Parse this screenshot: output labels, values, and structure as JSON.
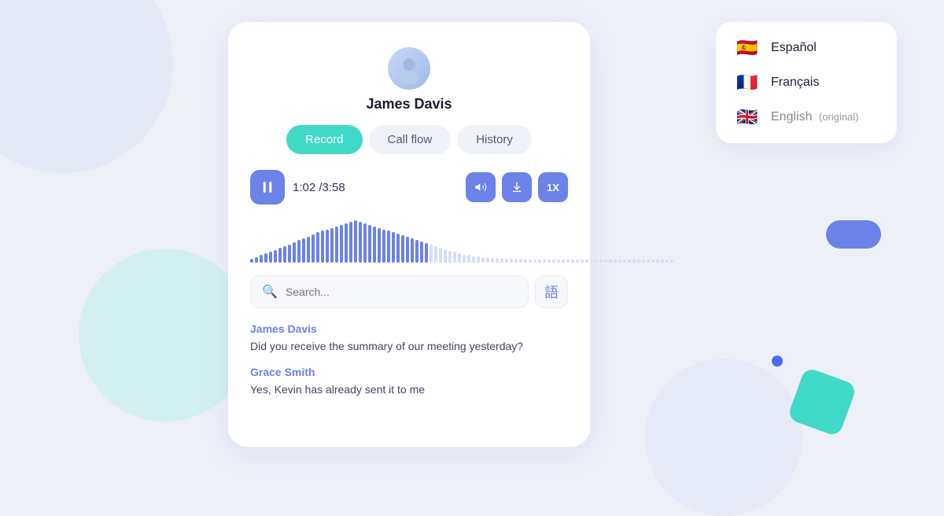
{
  "user": {
    "name": "James Davis"
  },
  "tabs": [
    {
      "id": "record",
      "label": "Record",
      "active": true
    },
    {
      "id": "callflow",
      "label": "Call flow",
      "active": false
    },
    {
      "id": "history",
      "label": "History",
      "active": false
    }
  ],
  "player": {
    "current_time": "1:02",
    "total_time": "3:58",
    "time_display": "1:02 /3:58",
    "speed_label": "1X"
  },
  "search": {
    "placeholder": "Search..."
  },
  "transcript": [
    {
      "speaker": "James Davis",
      "text": "Did you receive the summary of our meeting yesterday?"
    },
    {
      "speaker": "Grace Smith",
      "text": "Yes, Kevin has already sent it to me"
    }
  ],
  "languages": [
    {
      "flag": "🇪🇸",
      "name": "Español",
      "note": ""
    },
    {
      "flag": "🇫🇷",
      "name": "Français",
      "note": ""
    },
    {
      "flag": "🇬🇧",
      "name": "English",
      "note": "(original)"
    }
  ],
  "waveform": {
    "bars": [
      3,
      5,
      8,
      10,
      12,
      15,
      18,
      20,
      22,
      25,
      28,
      30,
      32,
      35,
      38,
      40,
      42,
      44,
      46,
      48,
      50,
      52,
      54,
      52,
      50,
      48,
      46,
      44,
      42,
      40,
      38,
      36,
      34,
      32,
      30,
      28,
      26,
      24,
      22,
      20,
      18,
      16,
      14,
      12,
      10,
      8,
      8,
      6,
      6,
      5,
      5,
      4,
      4,
      4,
      3,
      3,
      3,
      3,
      3,
      2,
      2,
      2,
      2,
      2,
      2,
      2,
      2,
      2,
      2,
      2,
      2,
      2,
      2,
      2,
      2,
      2,
      2,
      2,
      2,
      2,
      2,
      2,
      2,
      2,
      2,
      2,
      2,
      2,
      2,
      2
    ],
    "active_count": 38,
    "active_color": "#6b82e8",
    "inactive_color": "#d8ddf5"
  }
}
